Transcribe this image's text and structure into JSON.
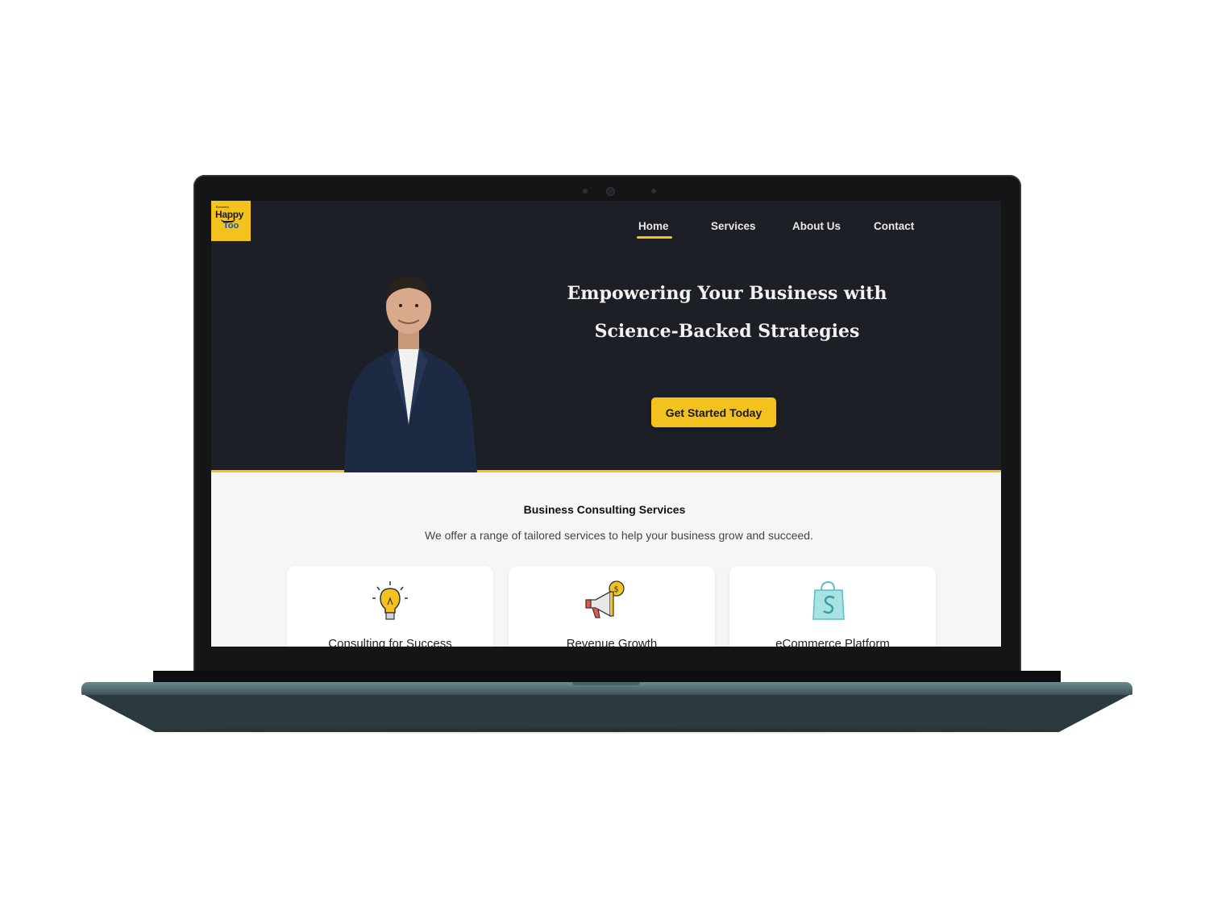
{
  "brand": {
    "logo_small": "Business",
    "logo_main": "Happy",
    "logo_sub": "Too",
    "accent_color": "#f4c21f",
    "hero_bg_color": "#1d1f26"
  },
  "nav": {
    "items": [
      {
        "label": "Home",
        "active": true
      },
      {
        "label": "Services",
        "active": false
      },
      {
        "label": "About Us",
        "active": false
      },
      {
        "label": "Contact",
        "active": false
      }
    ]
  },
  "hero": {
    "headline_line1": "Empowering Your Business with",
    "headline_line2": "Science-Backed Strategies",
    "cta_label": "Get Started Today"
  },
  "services": {
    "title": "Business Consulting Services",
    "subtitle": "We offer a range of tailored services to help your business grow and succeed.",
    "cards": [
      {
        "icon": "lightbulb-icon",
        "title": "Consulting for Success"
      },
      {
        "icon": "megaphone-icon",
        "title": "Revenue Growth"
      },
      {
        "icon": "shopify-bag-icon",
        "title": "eCommerce Platform"
      }
    ]
  }
}
